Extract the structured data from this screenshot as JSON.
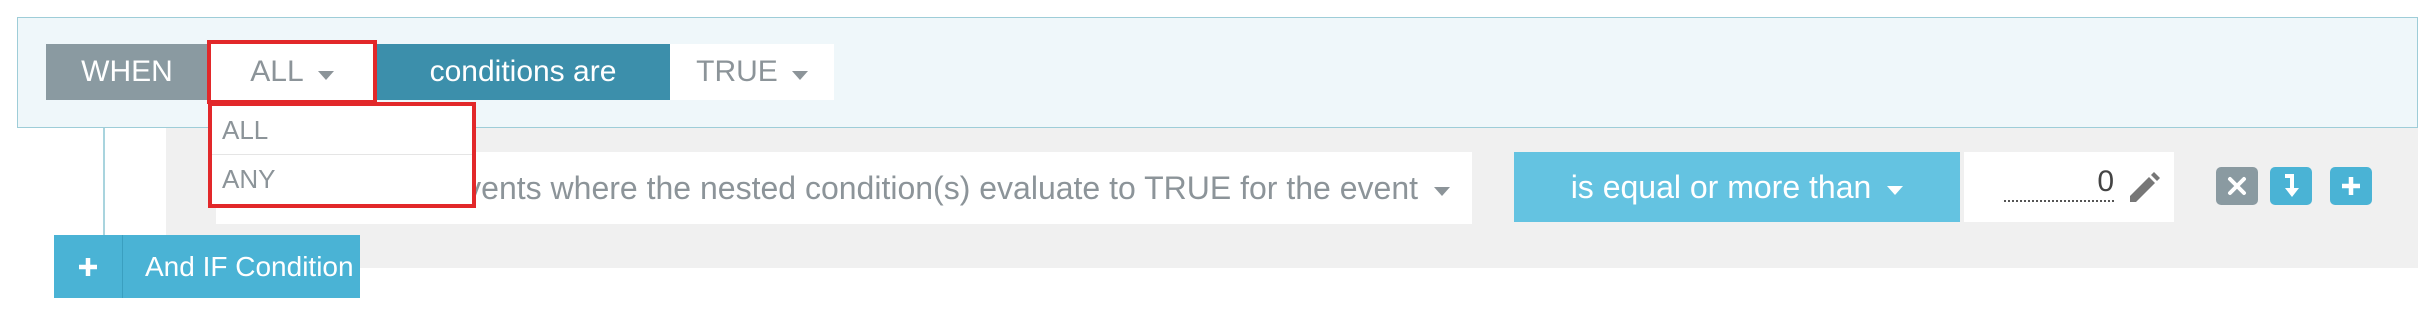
{
  "rule": {
    "when_label": "WHEN",
    "quantifier_selected": "ALL",
    "conditions_label": "conditions are",
    "truth_selected": "TRUE"
  },
  "quantifier_dropdown": {
    "options": [
      "ALL",
      "ANY"
    ]
  },
  "condition": {
    "field_text": "Events where the nested condition(s) evaluate to TRUE for the event",
    "operator_label": "is equal or more than",
    "value": "0"
  },
  "actions": {
    "add_if_label": "And IF Condition"
  },
  "icons": {
    "caret": "caret-down-icon",
    "pencil": "pencil-icon",
    "remove": "close-icon",
    "nest": "arrow-down-icon",
    "add": "plus-icon"
  },
  "colors": {
    "highlight": "#e2282a",
    "accent_dark": "#3c8fab",
    "accent_light": "#64c3e1",
    "button_blue": "#4ab3d5",
    "grey_label": "#8a9aa1"
  }
}
